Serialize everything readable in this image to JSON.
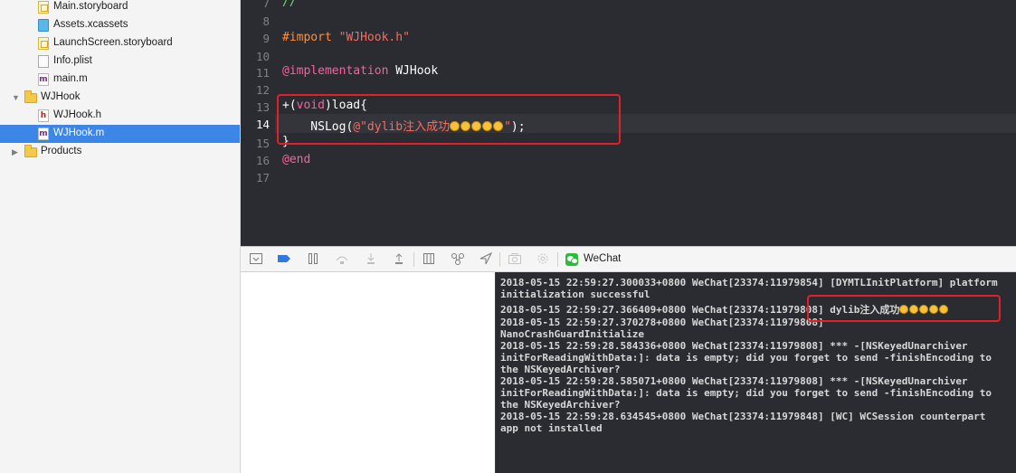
{
  "navigator": {
    "items": [
      {
        "label": "Main.storyboard",
        "icon": "storyboard-icon"
      },
      {
        "label": "Assets.xcassets",
        "icon": "assets-icon"
      },
      {
        "label": "LaunchScreen.storyboard",
        "icon": "storyboard-icon"
      },
      {
        "label": "Info.plist",
        "icon": "plist-icon"
      },
      {
        "label": "main.m",
        "icon": "m-file-icon",
        "glyph": "m"
      },
      {
        "label": "WJHook",
        "icon": "folder-icon",
        "expanded": true
      },
      {
        "label": "WJHook.h",
        "icon": "h-file-icon",
        "glyph": "h"
      },
      {
        "label": "WJHook.m",
        "icon": "m-file-icon",
        "glyph": "m",
        "selected": true
      },
      {
        "label": "Products",
        "icon": "folder-icon",
        "expanded": false
      }
    ]
  },
  "editor": {
    "line_numbers": [
      "7",
      "8",
      "9",
      "10",
      "11",
      "12",
      "13",
      "14",
      "15",
      "16",
      "17"
    ],
    "current_line": "14",
    "lines": {
      "l7": "//",
      "l9_kw": "#import",
      "l9_str": "\"WJHook.h\"",
      "l11_kw": "@implementation",
      "l11_name": "WJHook",
      "l13_a": "+(",
      "l13_kw": "void",
      "l13_b": ")load{",
      "l14_a": "    NSLog(",
      "l14_str": "@\"dylib注入成功",
      "l14_str_end": "\"",
      "l14_b": ");",
      "l15": "}",
      "l16_kw": "@end"
    }
  },
  "debug_bar": {
    "process_label": "WeChat"
  },
  "console": {
    "lines": [
      "2018-05-15 22:59:27.300033+0800 WeChat[23374:11979854] [DYMTLInitPlatform] platform",
      "initialization successful",
      "2018-05-15 22:59:27.366409+0800 WeChat[23374:11979808] dylib注入成功",
      "2018-05-15 22:59:27.370278+0800 WeChat[23374:11979808]",
      "NanoCrashGuardInitialize",
      "2018-05-15 22:59:28.584336+0800 WeChat[23374:11979808] *** -[NSKeyedUnarchiver",
      "initForReadingWithData:]: data is empty; did you forget to send -finishEncoding to",
      "the NSKeyedArchiver?",
      "2018-05-15 22:59:28.585071+0800 WeChat[23374:11979808] *** -[NSKeyedUnarchiver",
      "initForReadingWithData:]: data is empty; did you forget to send -finishEncoding to",
      "the NSKeyedArchiver?",
      "2018-05-15 22:59:28.634545+0800 WeChat[23374:11979848] [WC] WCSession counterpart",
      "app not installed"
    ]
  },
  "colors": {
    "highlight": "#e3202a",
    "selection": "#3b86e6",
    "editor_bg": "#2b2c31"
  }
}
